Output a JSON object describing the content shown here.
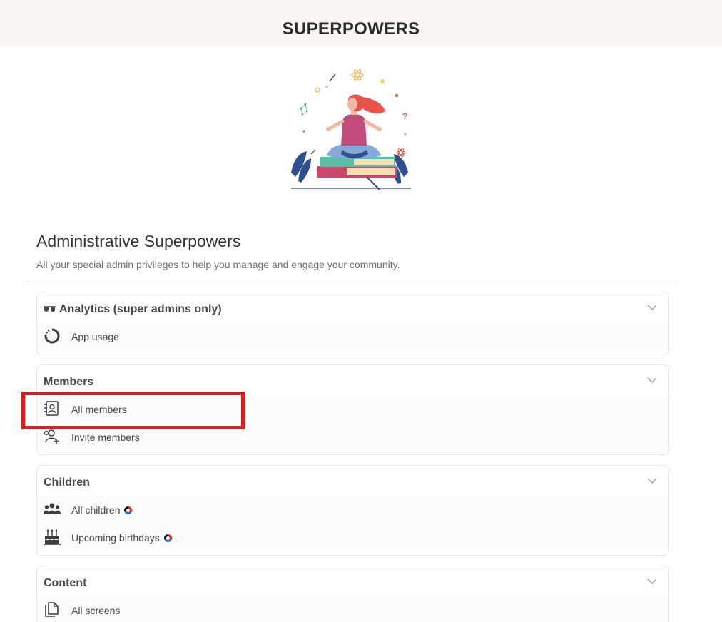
{
  "header": {
    "title": "SUPERPOWERS"
  },
  "page": {
    "heading": "Administrative Superpowers",
    "subheading": "All your special admin privileges to help you manage and engage your community."
  },
  "sections": [
    {
      "title": "Analytics (super admins only)",
      "title_icon": "sunglasses-icon",
      "items": [
        {
          "label": "App usage",
          "icon": "donut-chart-icon"
        }
      ]
    },
    {
      "title": "Members",
      "items": [
        {
          "label": "All members",
          "icon": "contact-book-icon"
        },
        {
          "label": "Invite members",
          "icon": "add-user-icon"
        }
      ]
    },
    {
      "title": "Children",
      "items": [
        {
          "label": "All children",
          "icon": "users-group-icon",
          "badge": true
        },
        {
          "label": "Upcoming birthdays",
          "icon": "birthday-cake-icon",
          "badge": true
        }
      ]
    },
    {
      "title": "Content",
      "items": [
        {
          "label": "All screens",
          "icon": "document-copy-icon"
        }
      ]
    }
  ],
  "colors": {
    "topbar_bg": "#f9f6f3",
    "highlight": "#e3191c",
    "divider": "#cfcfcf"
  }
}
